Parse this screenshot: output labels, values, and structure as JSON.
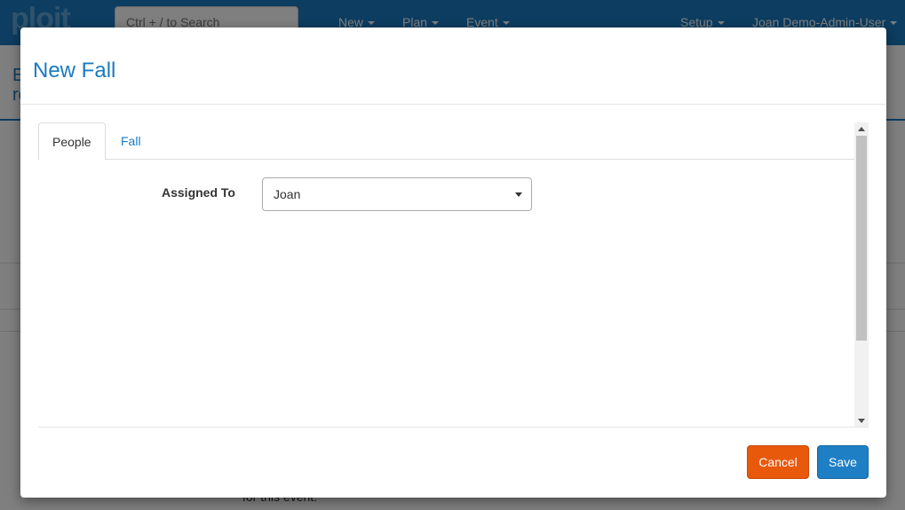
{
  "app": {
    "logo_text": "ploit",
    "search": {
      "placeholder": "Ctrl + / to Search"
    },
    "nav": [
      {
        "label": "New"
      },
      {
        "label": "Plan"
      },
      {
        "label": "Event"
      },
      {
        "label": "Setup"
      },
      {
        "label": "Joan Demo-Admin-User"
      }
    ],
    "page_heading_line1": "E",
    "page_heading_line2": "re",
    "footer_text": "for this event."
  },
  "modal": {
    "title": "New Fall",
    "tabs": [
      {
        "label": "People",
        "active": true
      },
      {
        "label": "Fall",
        "active": false
      }
    ],
    "fields": {
      "assigned_to": {
        "label": "Assigned To",
        "value": "Joan"
      }
    },
    "buttons": {
      "cancel": "Cancel",
      "save": "Save"
    }
  },
  "colors": {
    "brand_blue": "#1a7bc1",
    "cancel_orange": "#e8590c",
    "save_blue": "#1f7fc4"
  }
}
